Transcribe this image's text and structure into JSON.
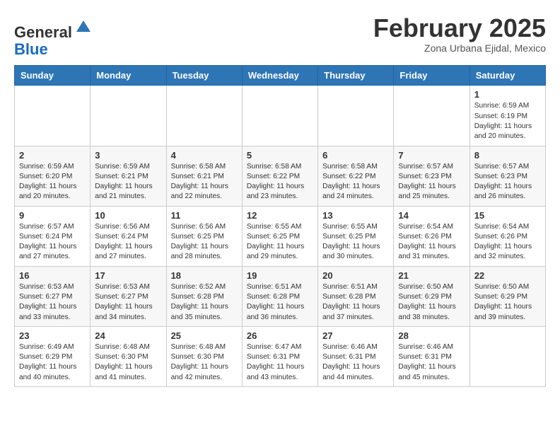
{
  "header": {
    "logo_general": "General",
    "logo_blue": "Blue",
    "month_title": "February 2025",
    "subtitle": "Zona Urbana Ejidal, Mexico"
  },
  "days_of_week": [
    "Sunday",
    "Monday",
    "Tuesday",
    "Wednesday",
    "Thursday",
    "Friday",
    "Saturday"
  ],
  "weeks": [
    [
      {
        "day": "",
        "info": ""
      },
      {
        "day": "",
        "info": ""
      },
      {
        "day": "",
        "info": ""
      },
      {
        "day": "",
        "info": ""
      },
      {
        "day": "",
        "info": ""
      },
      {
        "day": "",
        "info": ""
      },
      {
        "day": "1",
        "info": "Sunrise: 6:59 AM\nSunset: 6:19 PM\nDaylight: 11 hours and 20 minutes."
      }
    ],
    [
      {
        "day": "2",
        "info": "Sunrise: 6:59 AM\nSunset: 6:20 PM\nDaylight: 11 hours and 20 minutes."
      },
      {
        "day": "3",
        "info": "Sunrise: 6:59 AM\nSunset: 6:21 PM\nDaylight: 11 hours and 21 minutes."
      },
      {
        "day": "4",
        "info": "Sunrise: 6:58 AM\nSunset: 6:21 PM\nDaylight: 11 hours and 22 minutes."
      },
      {
        "day": "5",
        "info": "Sunrise: 6:58 AM\nSunset: 6:22 PM\nDaylight: 11 hours and 23 minutes."
      },
      {
        "day": "6",
        "info": "Sunrise: 6:58 AM\nSunset: 6:22 PM\nDaylight: 11 hours and 24 minutes."
      },
      {
        "day": "7",
        "info": "Sunrise: 6:57 AM\nSunset: 6:23 PM\nDaylight: 11 hours and 25 minutes."
      },
      {
        "day": "8",
        "info": "Sunrise: 6:57 AM\nSunset: 6:23 PM\nDaylight: 11 hours and 26 minutes."
      }
    ],
    [
      {
        "day": "9",
        "info": "Sunrise: 6:57 AM\nSunset: 6:24 PM\nDaylight: 11 hours and 27 minutes."
      },
      {
        "day": "10",
        "info": "Sunrise: 6:56 AM\nSunset: 6:24 PM\nDaylight: 11 hours and 27 minutes."
      },
      {
        "day": "11",
        "info": "Sunrise: 6:56 AM\nSunset: 6:25 PM\nDaylight: 11 hours and 28 minutes."
      },
      {
        "day": "12",
        "info": "Sunrise: 6:55 AM\nSunset: 6:25 PM\nDaylight: 11 hours and 29 minutes."
      },
      {
        "day": "13",
        "info": "Sunrise: 6:55 AM\nSunset: 6:25 PM\nDaylight: 11 hours and 30 minutes."
      },
      {
        "day": "14",
        "info": "Sunrise: 6:54 AM\nSunset: 6:26 PM\nDaylight: 11 hours and 31 minutes."
      },
      {
        "day": "15",
        "info": "Sunrise: 6:54 AM\nSunset: 6:26 PM\nDaylight: 11 hours and 32 minutes."
      }
    ],
    [
      {
        "day": "16",
        "info": "Sunrise: 6:53 AM\nSunset: 6:27 PM\nDaylight: 11 hours and 33 minutes."
      },
      {
        "day": "17",
        "info": "Sunrise: 6:53 AM\nSunset: 6:27 PM\nDaylight: 11 hours and 34 minutes."
      },
      {
        "day": "18",
        "info": "Sunrise: 6:52 AM\nSunset: 6:28 PM\nDaylight: 11 hours and 35 minutes."
      },
      {
        "day": "19",
        "info": "Sunrise: 6:51 AM\nSunset: 6:28 PM\nDaylight: 11 hours and 36 minutes."
      },
      {
        "day": "20",
        "info": "Sunrise: 6:51 AM\nSunset: 6:28 PM\nDaylight: 11 hours and 37 minutes."
      },
      {
        "day": "21",
        "info": "Sunrise: 6:50 AM\nSunset: 6:29 PM\nDaylight: 11 hours and 38 minutes."
      },
      {
        "day": "22",
        "info": "Sunrise: 6:50 AM\nSunset: 6:29 PM\nDaylight: 11 hours and 39 minutes."
      }
    ],
    [
      {
        "day": "23",
        "info": "Sunrise: 6:49 AM\nSunset: 6:29 PM\nDaylight: 11 hours and 40 minutes."
      },
      {
        "day": "24",
        "info": "Sunrise: 6:48 AM\nSunset: 6:30 PM\nDaylight: 11 hours and 41 minutes."
      },
      {
        "day": "25",
        "info": "Sunrise: 6:48 AM\nSunset: 6:30 PM\nDaylight: 11 hours and 42 minutes."
      },
      {
        "day": "26",
        "info": "Sunrise: 6:47 AM\nSunset: 6:31 PM\nDaylight: 11 hours and 43 minutes."
      },
      {
        "day": "27",
        "info": "Sunrise: 6:46 AM\nSunset: 6:31 PM\nDaylight: 11 hours and 44 minutes."
      },
      {
        "day": "28",
        "info": "Sunrise: 6:46 AM\nSunset: 6:31 PM\nDaylight: 11 hours and 45 minutes."
      },
      {
        "day": "",
        "info": ""
      }
    ]
  ]
}
